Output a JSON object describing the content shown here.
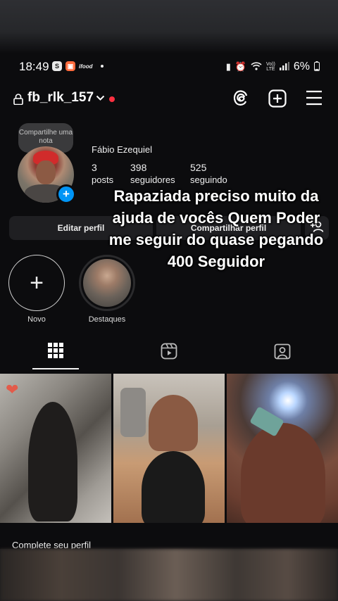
{
  "status_bar": {
    "time": "18:49",
    "left_icons": [
      "s-app-icon",
      "shopee-icon",
      "ifood-icon"
    ],
    "ifood_text": "ifood",
    "volte_top": "Vo))",
    "volte_bottom": "LTE",
    "battery": "6%"
  },
  "header": {
    "username": "fb_rlk_157"
  },
  "profile": {
    "note": "Compartilhe uma nota",
    "full_name": "Fábio Ezequiel",
    "posts_count": "3",
    "posts_label": "posts",
    "followers_count": "398",
    "followers_label": "seguidores",
    "following_count": "525",
    "following_label": "seguindo"
  },
  "buttons": {
    "edit_profile": "Editar perfil",
    "share_profile": "Compartilhar perfil"
  },
  "highlights": {
    "new_label": "Novo",
    "dest_label": "Destaques"
  },
  "overlay_text": "Rapaziada preciso muito da ajuda de vocês Quem Poder me seguir do quase pegando 400 Seguidor",
  "footer": {
    "complete_profile": "Complete seu perfil"
  },
  "colors": {
    "accent_blue": "#0095f6",
    "notification_red": "#ff3040",
    "background": "#0c0c0e"
  }
}
